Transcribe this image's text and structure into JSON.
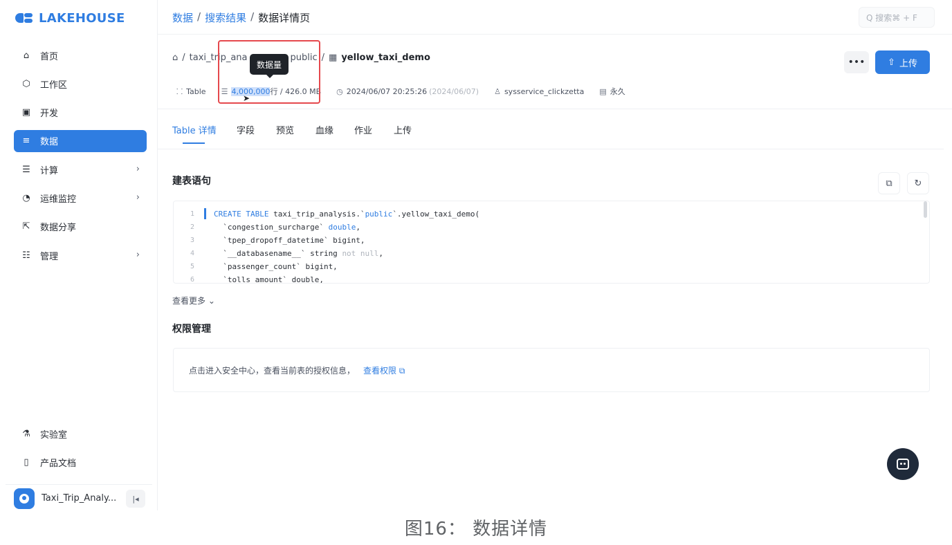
{
  "app": {
    "logo_text": "LAKEHOUSE",
    "accent": "#2f7de1"
  },
  "sidebar": {
    "items": [
      {
        "label": "首页",
        "icon": "home-icon",
        "glyph": "⌂",
        "chevron": false,
        "active": false
      },
      {
        "label": "工作区",
        "icon": "cube-icon",
        "glyph": "⬡",
        "chevron": false,
        "active": false
      },
      {
        "label": "开发",
        "icon": "terminal-icon",
        "glyph": "▣",
        "chevron": false,
        "active": false
      },
      {
        "label": "数据",
        "icon": "database-icon",
        "glyph": "≡",
        "chevron": false,
        "active": true
      },
      {
        "label": "计算",
        "icon": "compute-icon",
        "glyph": "☰",
        "chevron": true,
        "active": false
      },
      {
        "label": "运维监控",
        "icon": "monitor-icon",
        "glyph": "◔",
        "chevron": true,
        "active": false
      },
      {
        "label": "数据分享",
        "icon": "share-icon",
        "glyph": "⇱",
        "chevron": false,
        "active": false
      },
      {
        "label": "管理",
        "icon": "manage-icon",
        "glyph": "☷",
        "chevron": true,
        "active": false
      }
    ],
    "bottom_items": [
      {
        "label": "实验室",
        "icon": "flask-icon",
        "glyph": "⚗"
      },
      {
        "label": "产品文档",
        "icon": "book-icon",
        "glyph": "▯"
      }
    ],
    "user_name": "Taxi_Trip_Analy...",
    "collapse_glyph": "|◂"
  },
  "topbar": {
    "breadcrumbs": [
      "数据",
      "搜索结果",
      "数据详情页"
    ],
    "search_placeholder": "Q 搜索⌘ + F"
  },
  "header": {
    "path": {
      "home_glyph": "⌂",
      "catalog": "taxi_trip_ana",
      "schema": "public",
      "table_name": "yellow_taxi_demo"
    },
    "tooltip": "数据量",
    "meta": {
      "type": "Table",
      "rows_value": "4,000,000",
      "rows_suffix": "行 / 426.0 MB",
      "created": "2024/06/07 20:25:26",
      "created_muted": "(2024/06/07)",
      "owner": "sysservice_clickzetta",
      "lifecycle": "永久"
    },
    "more_label": "•••",
    "upload_label": "上传"
  },
  "tabs": [
    "Table 详情",
    "字段",
    "预览",
    "血缘",
    "作业",
    "上传"
  ],
  "ddl": {
    "title": "建表语句",
    "lines": [
      {
        "n": "1",
        "parts": [
          {
            "t": "CREATE TABLE",
            "c": "kw"
          },
          {
            "t": " taxi_trip_analysis.`",
            "c": ""
          },
          {
            "t": "public",
            "c": "kw"
          },
          {
            "t": "`.yellow_taxi_demo(",
            "c": ""
          }
        ]
      },
      {
        "n": "2",
        "parts": [
          {
            "t": "  `congestion_surcharge` ",
            "c": ""
          },
          {
            "t": "double",
            "c": "kw"
          },
          {
            "t": ",",
            "c": ""
          }
        ]
      },
      {
        "n": "3",
        "parts": [
          {
            "t": "  `tpep_dropoff_datetime` bigint,",
            "c": ""
          }
        ]
      },
      {
        "n": "4",
        "parts": [
          {
            "t": "  `__databasename__` string ",
            "c": ""
          },
          {
            "t": "not null",
            "c": "mut"
          },
          {
            "t": ",",
            "c": ""
          }
        ]
      },
      {
        "n": "5",
        "parts": [
          {
            "t": "  `passenger_count` bigint,",
            "c": ""
          }
        ]
      },
      {
        "n": "6",
        "parts": [
          {
            "t": "  `tolls_amount` double,",
            "c": ""
          }
        ]
      }
    ],
    "see_more": "查看更多 ⌄"
  },
  "permissions": {
    "title": "权限管理",
    "text": "点击进入安全中心，查看当前表的授权信息，",
    "link": "查看权限 ⧉"
  },
  "caption": "图16： 数据详情"
}
